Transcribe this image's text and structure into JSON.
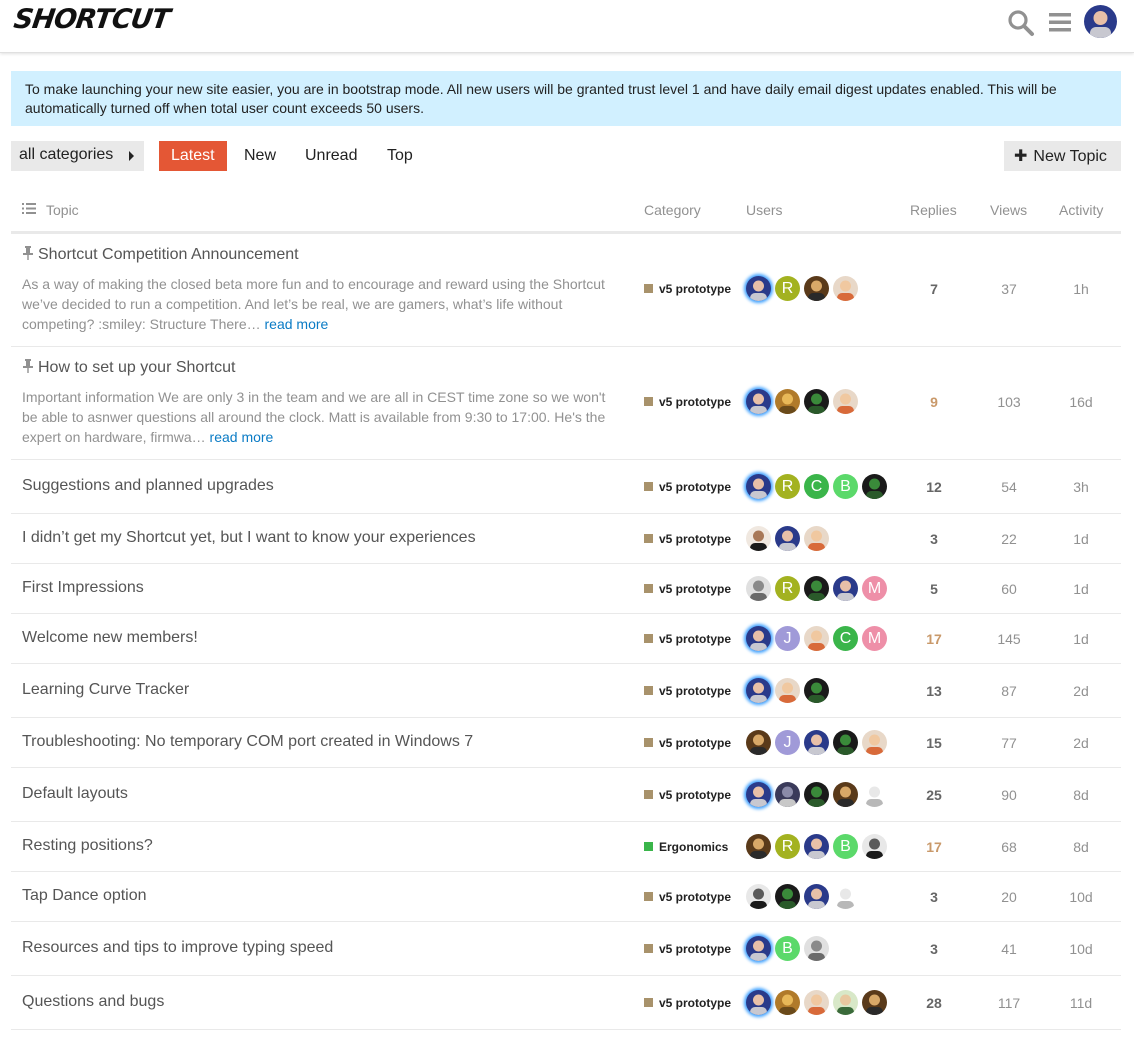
{
  "header": {
    "logo": "SHORTCUT",
    "search_icon": "search-icon",
    "menu_icon": "hamburger-menu-icon",
    "avatar": "user-avatar"
  },
  "banner": {
    "text": "To make launching your new site easier, you are in bootstrap mode. All new users will be granted trust level 1 and have daily email digest updates enabled. This will be automatically turned off when total user count exceeds 50 users."
  },
  "nav": {
    "category_dropdown": "all categories",
    "tabs": [
      "Latest",
      "New",
      "Unread",
      "Top"
    ],
    "active_tab": "Latest",
    "new_topic": "New Topic"
  },
  "colors": {
    "accent": "#e45735",
    "banner_bg": "#d1f0ff",
    "link": "#0a7bc5",
    "category_v5": "#a8926b",
    "category_ergonomics": "#3ab54a"
  },
  "table": {
    "columns": {
      "topic": "Topic",
      "category": "Category",
      "users": "Users",
      "replies": "Replies",
      "views": "Views",
      "activity": "Activity"
    },
    "rows": [
      {
        "title": "Shortcut Competition Announcement",
        "pinned": true,
        "excerpt": "As a way of making the closed beta more fun and to encourage and reward using the Shortcut we’ve decided to run a competition. And let’s be real, we are gamers, what’s life without competing? :smiley: Structure There…",
        "read_more": "read more",
        "category": "v5 prototype",
        "users": [
          "photo-man",
          "letter-R",
          "photo-face",
          "photo-toon"
        ],
        "replies": "7",
        "views": "37",
        "activity": "1h"
      },
      {
        "title": "How to set up your Shortcut",
        "pinned": true,
        "excerpt": "Important information We are only 3 in the team and we are all in CEST time zone so we won't be able to asnwer questions all around the clock. Matt is available from 9:30 to 17:00. He's the expert on hardware, firmwa…",
        "read_more": "read more",
        "category": "v5 prototype",
        "users": [
          "photo-man",
          "photo-gold",
          "photo-dark",
          "photo-toon"
        ],
        "replies": "9",
        "views": "103",
        "activity": "16d"
      },
      {
        "title": "Suggestions and planned upgrades",
        "category": "v5 prototype",
        "users": [
          "photo-man",
          "letter-R",
          "letter-C",
          "letter-B",
          "photo-dark"
        ],
        "replies": "12",
        "views": "54",
        "activity": "3h"
      },
      {
        "title": "I didn’t get my Shortcut yet, but I want to know your experiences",
        "category": "v5 prototype",
        "users": [
          "photo-hat",
          "photo-man",
          "photo-toon"
        ],
        "replies": "3",
        "views": "22",
        "activity": "1d"
      },
      {
        "title": "First Impressions",
        "category": "v5 prototype",
        "users": [
          "photo-gear",
          "letter-R",
          "photo-dark",
          "photo-man",
          "letter-M"
        ],
        "replies": "5",
        "views": "60",
        "activity": "1d"
      },
      {
        "title": "Welcome new members!",
        "category": "v5 prototype",
        "users": [
          "photo-man",
          "letter-J",
          "photo-toon",
          "letter-C",
          "letter-M"
        ],
        "replies": "17",
        "views": "145",
        "activity": "1d"
      },
      {
        "title": "Learning Curve Tracker",
        "category": "v5 prototype",
        "users": [
          "photo-man",
          "photo-toon",
          "photo-dark"
        ],
        "replies": "13",
        "views": "87",
        "activity": "2d"
      },
      {
        "title": "Troubleshooting: No temporary COM port created in Windows 7",
        "category": "v5 prototype",
        "users": [
          "photo-face",
          "letter-J",
          "photo-man",
          "photo-dark",
          "photo-toon"
        ],
        "replies": "15",
        "views": "77",
        "activity": "2d"
      },
      {
        "title": "Default layouts",
        "category": "v5 prototype",
        "users": [
          "photo-man",
          "photo-knight",
          "photo-dark",
          "photo-face",
          "photo-sketch"
        ],
        "replies": "25",
        "views": "90",
        "activity": "8d"
      },
      {
        "title": "Resting positions?",
        "category": "Ergonomics",
        "users": [
          "photo-face",
          "letter-R",
          "photo-man",
          "letter-B",
          "photo-bw"
        ],
        "replies": "17",
        "views": "68",
        "activity": "8d"
      },
      {
        "title": "Tap Dance option",
        "category": "v5 prototype",
        "users": [
          "photo-bw",
          "photo-dark",
          "photo-man",
          "photo-sketch"
        ],
        "replies": "3",
        "views": "20",
        "activity": "10d"
      },
      {
        "title": "Resources and tips to improve typing speed",
        "category": "v5 prototype",
        "users": [
          "photo-man",
          "letter-B",
          "photo-gear"
        ],
        "replies": "3",
        "views": "41",
        "activity": "10d"
      },
      {
        "title": "Questions and bugs",
        "category": "v5 prototype",
        "users": [
          "photo-man",
          "photo-gold",
          "photo-toon",
          "photo-cartoon",
          "photo-face"
        ],
        "replies": "28",
        "views": "117",
        "activity": "11d"
      }
    ]
  }
}
